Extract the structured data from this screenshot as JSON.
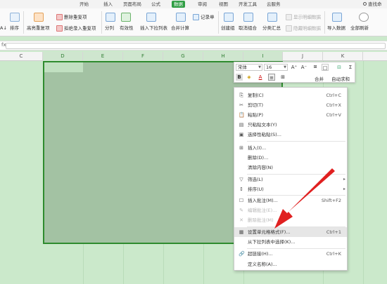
{
  "tabs": {
    "items": [
      "开始",
      "插入",
      "页面布局",
      "公式",
      "数据",
      "审阅",
      "视图",
      "开发工具",
      "云服务"
    ],
    "active": "数据",
    "find": "查找命"
  },
  "ribbon": {
    "autofilter": "排序",
    "highlight_dup": "高亮重复项",
    "remove_dup": "删除重复项",
    "reject_dup": "拒绝录入重复项",
    "split": "分列",
    "validity": "有效性",
    "insert_dropdown": "插入下拉列表",
    "merge_calc": "合并计算",
    "record": "记录单",
    "create_group": "创建组",
    "ungroup": "取消组合",
    "subtotal": "分类汇总",
    "show_detail": "显示明细数据",
    "hide_detail": "隐藏明细数据",
    "import": "导入数据",
    "refresh_all": "全部刷新",
    "sort_prefix": "A↓"
  },
  "formula_bar": {
    "fx": "fx"
  },
  "columns": [
    "C",
    "D",
    "E",
    "F",
    "G",
    "H",
    "I",
    "J",
    "K"
  ],
  "selected_columns": [
    "D",
    "E",
    "F",
    "G",
    "H",
    "I"
  ],
  "mini_toolbar": {
    "font_name": "宋体",
    "font_size": "16",
    "grow": "A⁺",
    "shrink": "A⁻",
    "bold": "B",
    "merge_label": "合并",
    "autosum_label": "自动求和"
  },
  "context_menu": {
    "items": [
      {
        "icon": "copy-icon",
        "glyph": "⎘",
        "label": "复制(C)",
        "shortcut": "Ctrl+C"
      },
      {
        "icon": "cut-icon",
        "glyph": "✂",
        "label": "剪切(T)",
        "shortcut": "Ctrl+X"
      },
      {
        "icon": "paste-icon",
        "glyph": "📋",
        "label": "粘贴(P)",
        "shortcut": "Ctrl+V"
      },
      {
        "icon": "paste-text-icon",
        "glyph": "▤",
        "label": "只粘贴文本(Y)",
        "shortcut": ""
      },
      {
        "icon": "paste-special-icon",
        "glyph": "▣",
        "label": "选择性粘贴(S)...",
        "shortcut": ""
      },
      {
        "icon": "insert-icon",
        "glyph": "⊞",
        "label": "插入(I)...",
        "shortcut": ""
      },
      {
        "icon": "",
        "glyph": "",
        "label": "删除(D)...",
        "shortcut": ""
      },
      {
        "icon": "",
        "glyph": "",
        "label": "清除内容(N)",
        "shortcut": ""
      },
      {
        "icon": "filter-icon",
        "glyph": "▽",
        "label": "筛选(L)",
        "shortcut": ""
      },
      {
        "icon": "sort-icon",
        "glyph": "↕",
        "label": "排序(U)",
        "shortcut": ""
      },
      {
        "icon": "comment-icon",
        "glyph": "☐",
        "label": "插入批注(M)...",
        "shortcut": "Shift+F2"
      },
      {
        "icon": "edit-comment-icon",
        "glyph": "✎",
        "label": "编辑批注(E)...",
        "shortcut": ""
      },
      {
        "icon": "delete-comment-icon",
        "glyph": "✕",
        "label": "删除批注(M)",
        "shortcut": ""
      },
      {
        "icon": "format-cells-icon",
        "glyph": "▦",
        "label": "设置单元格格式(F)...",
        "shortcut": "Ctrl+1"
      },
      {
        "icon": "",
        "glyph": "",
        "label": "从下拉列表中选择(K)...",
        "shortcut": ""
      },
      {
        "icon": "hyperlink-icon",
        "glyph": "🔗",
        "label": "超链接(H)...",
        "shortcut": "Ctrl+K"
      },
      {
        "icon": "",
        "glyph": "",
        "label": "定义名称(A)...",
        "shortcut": ""
      }
    ]
  },
  "colors": {
    "accent": "#2f9e44",
    "sheet_bg": "#cbe9cb",
    "selection_border": "#2e8b2e",
    "arrow": "#e02020"
  }
}
